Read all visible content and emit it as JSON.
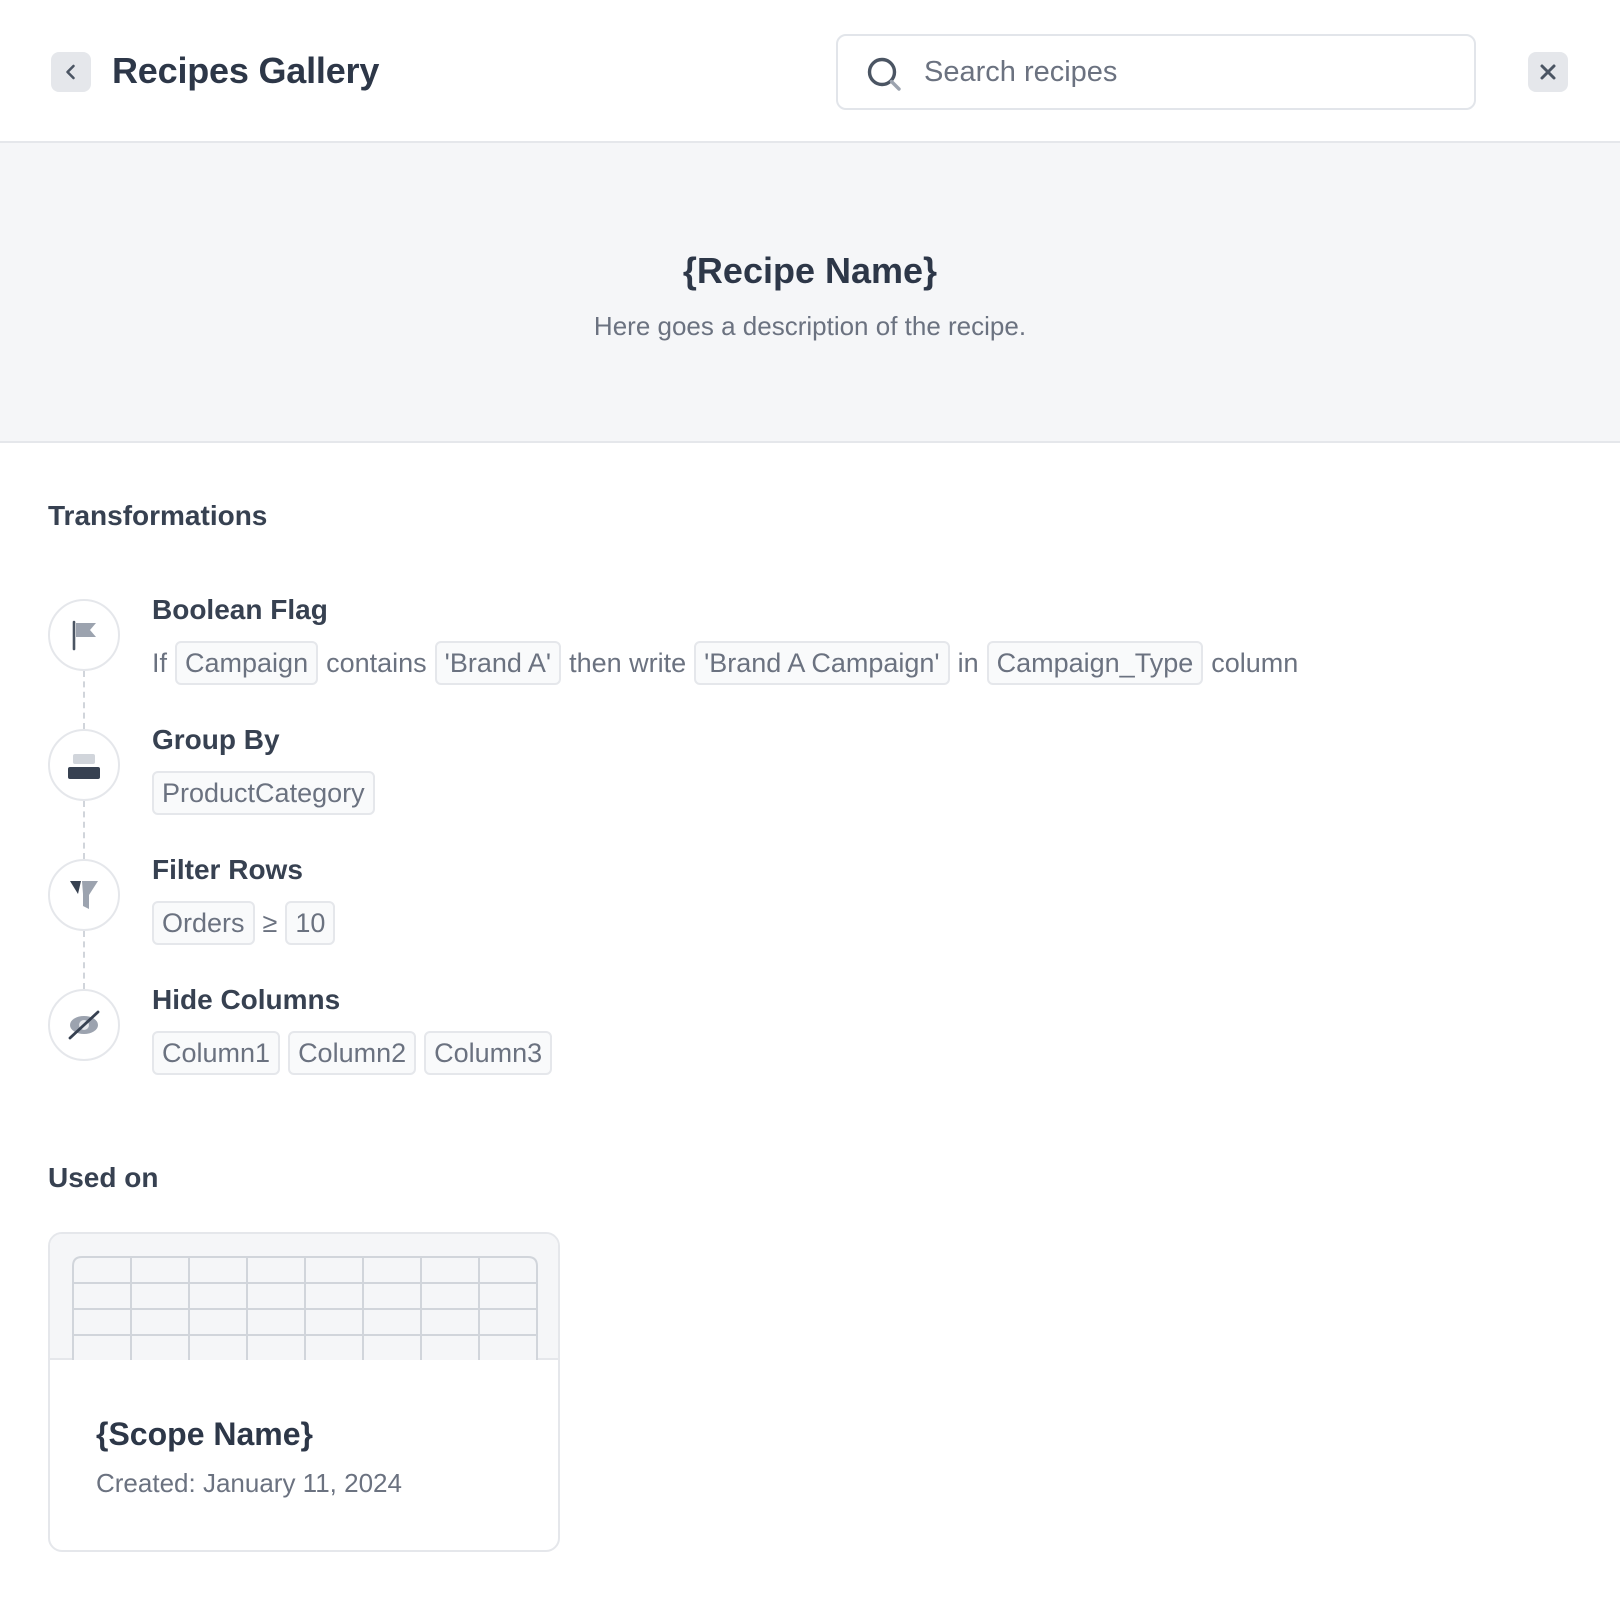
{
  "header": {
    "title": "Recipes Gallery",
    "search_placeholder": "Search recipes"
  },
  "recipe": {
    "name": "{Recipe Name}",
    "description": "Here goes a description of the recipe."
  },
  "transformations": {
    "heading": "Transformations",
    "steps": [
      {
        "title": "Boolean Flag",
        "icon": "flag-icon",
        "parts": {
          "if": "If",
          "column": "Campaign",
          "contains": "contains",
          "value": "'Brand A'",
          "then_write": "then write",
          "output": "'Brand A Campaign'",
          "in": "in",
          "target": "Campaign_Type",
          "suffix": "column"
        }
      },
      {
        "title": "Group By",
        "icon": "group-icon",
        "chips": [
          "ProductCategory"
        ]
      },
      {
        "title": "Filter Rows",
        "icon": "filter-icon",
        "parts": {
          "column": "Orders",
          "operator": "≥",
          "value": "10"
        }
      },
      {
        "title": "Hide Columns",
        "icon": "eye-off-icon",
        "chips": [
          "Column1",
          "Column2",
          "Column3"
        ]
      }
    ]
  },
  "used_on": {
    "heading": "Used on",
    "scope": {
      "name": "{Scope Name}",
      "created": "Created: January 11, 2024"
    }
  },
  "colors": {
    "text_dark": "#2d3748",
    "text_muted": "#6b7280",
    "border": "#e5e7eb",
    "hero_bg": "#f5f6f8"
  }
}
